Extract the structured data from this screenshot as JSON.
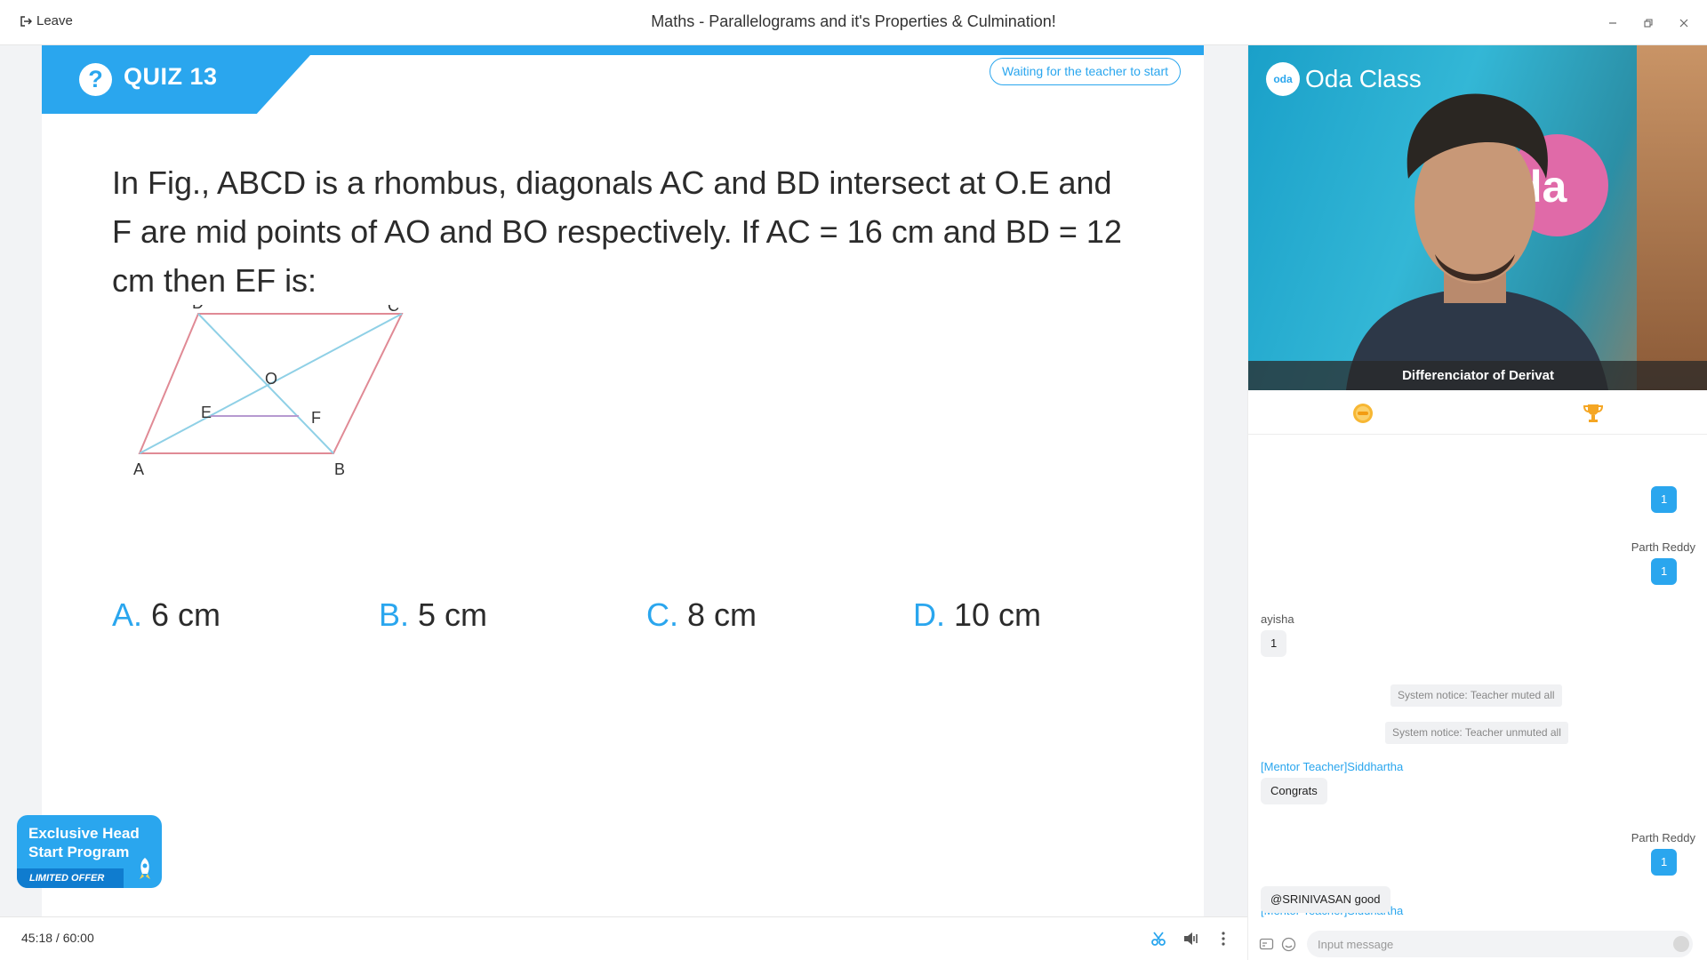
{
  "titlebar": {
    "leave_label": "Leave",
    "title": "Maths - Parallelograms and it's Properties & Culmination!"
  },
  "quiz": {
    "label": "QUIZ 13",
    "status": "Waiting for the teacher to start",
    "question": "In Fig., ABCD is a rhombus, diagonals AC and BD intersect at O.E and F are mid points of AO and BO respectively. If AC = 16 cm and BD = 12 cm then EF is:",
    "figure_labels": {
      "a": "A",
      "b": "B",
      "c": "C",
      "d": "D",
      "o": "O",
      "e": "E",
      "f": "F"
    },
    "options": [
      {
        "letter": "A.",
        "text": "6 cm"
      },
      {
        "letter": "B.",
        "text": "5 cm"
      },
      {
        "letter": "C.",
        "text": "8 cm"
      },
      {
        "letter": "D.",
        "text": "10 cm"
      }
    ]
  },
  "promo": {
    "title": "Exclusive Head Start Program",
    "offer": "LIMITED OFFER"
  },
  "bottombar": {
    "timer": "45:18  / 60:00"
  },
  "video": {
    "brand": "Oda Class",
    "brand_logo": "oda",
    "blob_text": "da",
    "name": "Differenciator of Derivat"
  },
  "chat": {
    "messages": [
      {
        "sender": "",
        "text": "1"
      },
      {
        "sender": "Parth Reddy",
        "text": "1"
      },
      {
        "sender": "ayisha",
        "text": "1"
      },
      {
        "notice": "System notice: Teacher muted all"
      },
      {
        "notice": "System notice: Teacher unmuted all"
      },
      {
        "sender": "[Mentor Teacher]Siddhartha",
        "text": "Congrats"
      },
      {
        "sender": "Parth Reddy",
        "text": "1"
      },
      {
        "sender": "[Mentor Teacher]Siddhartha",
        "text": "@SRINIVASAN good"
      }
    ],
    "input_placeholder": "Input message"
  },
  "colors": {
    "accent": "#2aa6ee",
    "promo_dark": "#0f7ccf",
    "trophy": "#f5a623"
  }
}
